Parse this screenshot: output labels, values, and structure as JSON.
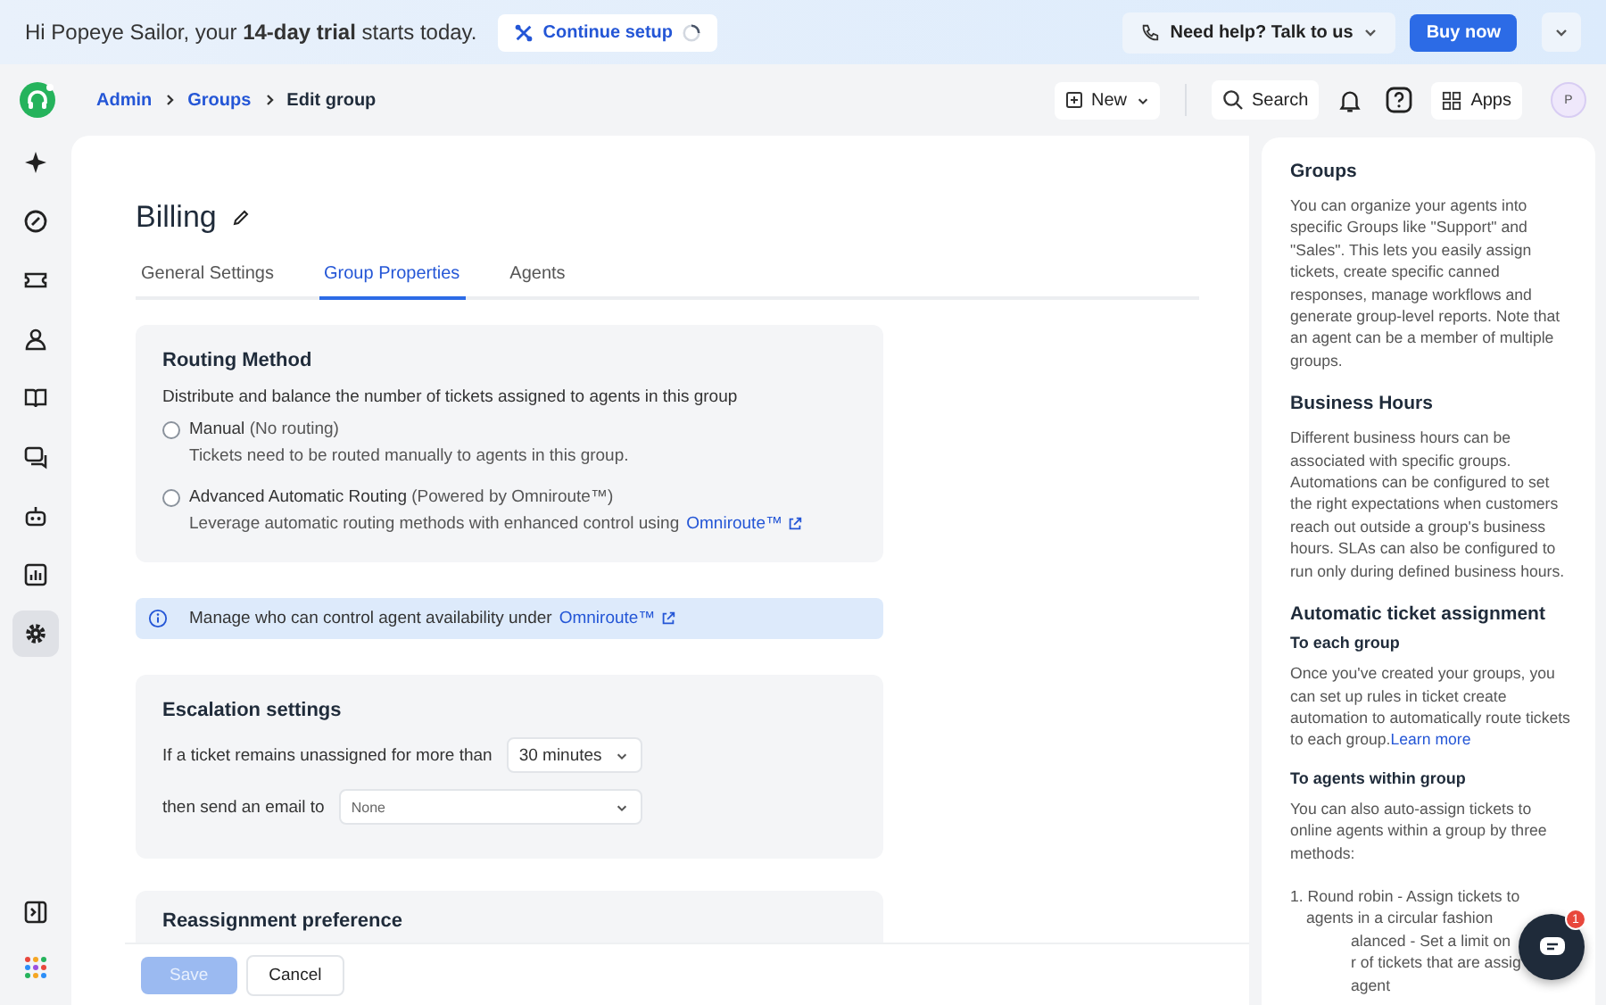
{
  "banner": {
    "greeting": "Hi Popeye Sailor, your **14-day trial** starts today.",
    "setup_button": "Continue setup",
    "help_button": "Need help? Talk to us",
    "buy_button": "Buy now"
  },
  "breadcrumb": [
    {
      "label": "Admin",
      "kind": "link"
    },
    {
      "label": "Groups",
      "kind": "link"
    },
    {
      "label": "Edit group",
      "kind": "current"
    }
  ],
  "toolbar": {
    "new_button": "New",
    "search_button": "Search",
    "apps_button": "Apps",
    "avatar": "P"
  },
  "sidebar": {
    "items": [
      {
        "kind": "sparkle",
        "selected": false
      },
      {
        "kind": "gauge",
        "selected": false
      },
      {
        "kind": "ticket",
        "selected": false
      },
      {
        "kind": "contact",
        "selected": false
      },
      {
        "kind": "book",
        "selected": false
      },
      {
        "kind": "chat",
        "selected": false
      },
      {
        "kind": "bot",
        "selected": false
      },
      {
        "kind": "chart",
        "selected": false
      },
      {
        "kind": "settings",
        "selected": true
      }
    ]
  },
  "page": {
    "title": "Billing",
    "tabs": [
      {
        "label": "General Settings",
        "selected": false
      },
      {
        "label": "Group Properties",
        "selected": true
      },
      {
        "label": "Agents",
        "selected": false
      }
    ],
    "routing": {
      "title": "Routing Method",
      "description": "Distribute and balance the number of tickets assigned to agents in this group",
      "options": [
        {
          "label": "Manual",
          "note": "(No routing)",
          "description": "Tickets need to be routed manually to agents in this group.",
          "selected": false
        },
        {
          "label": "Advanced Automatic Routing",
          "note": "(Powered by Omniroute™)",
          "description": "Leverage automatic routing methods with enhanced control using",
          "link": "Omniroute™",
          "selected": false
        }
      ]
    },
    "info": {
      "text": "Manage who can control agent availability under",
      "link": "Omniroute™"
    },
    "escalation": {
      "title": "Escalation settings",
      "rows": [
        {
          "label": "If a ticket remains unassigned for more than",
          "value": "30 minutes",
          "kind": "compact"
        },
        {
          "label": "then send an email to",
          "placeholder": "None",
          "kind": "wide"
        }
      ]
    },
    "reassignment": {
      "title": "Reassignment preference"
    },
    "save_button": {
      "label": "Save",
      "disabled": true
    },
    "cancel_button": {
      "label": "Cancel"
    }
  },
  "help": [
    {
      "kind": "heading",
      "text": "Groups"
    },
    {
      "kind": "paragraph",
      "text": "You can organize your agents into specific Groups like \"Support\" and \"Sales\". This lets you easily assign tickets, create specific canned responses, manage workflows and generate group-level reports. Note that an agent can be a member of multiple groups."
    },
    {
      "kind": "heading",
      "text": "Business Hours"
    },
    {
      "kind": "paragraph",
      "text": "Different business hours can be associated with specific groups. Automations can be configured to set the right expectations when customers reach out outside a group's business hours. SLAs can also be configured to run only during defined business hours."
    },
    {
      "kind": "heading",
      "text": "Automatic ticket assignment"
    },
    {
      "kind": "subheading",
      "text": "To each group"
    },
    {
      "kind": "paragraph",
      "text": "Once you've created your groups, you can set up rules in ticket create automation to automatically route tickets to each group.",
      "link": "Learn more"
    },
    {
      "kind": "subheading",
      "text": "To agents within group"
    },
    {
      "kind": "paragraph",
      "text": "You can also auto-assign tickets to online agents within a group by three methods:"
    },
    {
      "kind": "line",
      "text": "1. Round robin - Assign tickets to"
    },
    {
      "kind": "indent",
      "text": "agents in a circular fashion"
    },
    {
      "kind": "cut",
      "text": "alanced - Set a limit on"
    },
    {
      "kind": "cut",
      "text": "r of tickets that are assig"
    },
    {
      "kind": "cut",
      "text": "agent"
    }
  ],
  "chat": {
    "badge": "1"
  }
}
